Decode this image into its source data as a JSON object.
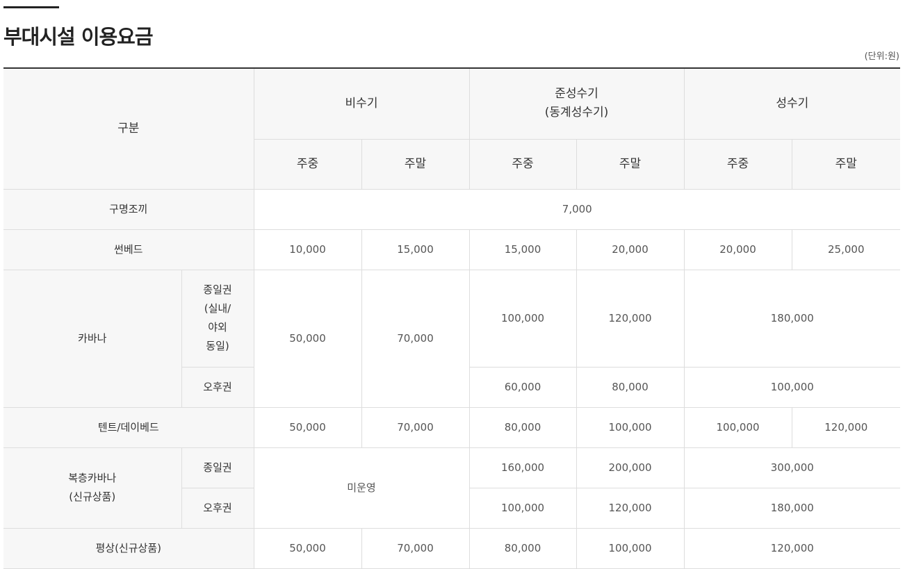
{
  "title": "부대시설 이용요금",
  "unit": "(단위:원)",
  "header": {
    "category": "구분",
    "seasons": [
      "비수기",
      "준성수기",
      "(동계성수기)",
      "성수기"
    ],
    "weekday": "주중",
    "weekend": "주말"
  },
  "rows": {
    "r1": {
      "label": "구명조끼",
      "all": "7,000"
    },
    "r2": {
      "label": "썬베드",
      "values": [
        "10,000",
        "15,000",
        "15,000",
        "20,000",
        "20,000",
        "25,000"
      ]
    },
    "r3": {
      "label": "카바나",
      "sub1_lines": [
        "종일권",
        "(실내/",
        "야외",
        "동일)"
      ],
      "sub2": "오후권",
      "off_weekday": "50,000",
      "off_weekend": "70,000",
      "sub1_values": [
        "100,000",
        "120,000",
        "180,000"
      ],
      "sub2_values": [
        "60,000",
        "80,000",
        "100,000"
      ]
    },
    "r4": {
      "label": "텐트/데이베드",
      "values": [
        "50,000",
        "70,000",
        "80,000",
        "100,000",
        "100,000",
        "120,000"
      ]
    },
    "r5": {
      "label_lines": [
        "복층카바나",
        "(신규상품)"
      ],
      "sub1": "종일권",
      "sub2": "오후권",
      "off": "미운영",
      "sub1_values": [
        "160,000",
        "200,000",
        "300,000"
      ],
      "sub2_values": [
        "100,000",
        "120,000",
        "180,000"
      ]
    },
    "r6": {
      "label": "평상(신규상품)",
      "values": [
        "50,000",
        "70,000",
        "80,000",
        "100,000",
        "120,000"
      ]
    }
  }
}
